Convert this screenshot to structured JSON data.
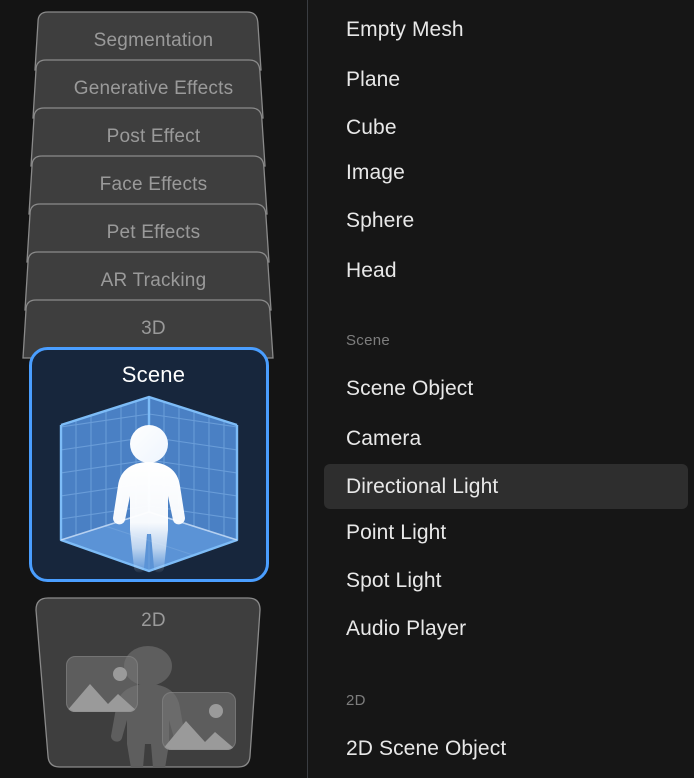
{
  "sidebar": {
    "cards": [
      {
        "label": "Segmentation",
        "selected": false,
        "icon": null
      },
      {
        "label": "Generative Effects",
        "selected": false,
        "icon": null
      },
      {
        "label": "Post Effect",
        "selected": false,
        "icon": null
      },
      {
        "label": "Face Effects",
        "selected": false,
        "icon": null
      },
      {
        "label": "Pet Effects",
        "selected": false,
        "icon": null
      },
      {
        "label": "AR Tracking",
        "selected": false,
        "icon": null
      },
      {
        "label": "3D",
        "selected": false,
        "icon": null
      },
      {
        "label": "Scene",
        "selected": true,
        "icon": "scene-room-person-icon"
      },
      {
        "label": "2D",
        "selected": false,
        "icon": "twod-person-images-icon"
      }
    ]
  },
  "menu": {
    "items": [
      {
        "label": "Empty Mesh",
        "kind": "item",
        "highlighted": false
      },
      {
        "label": "Plane",
        "kind": "item",
        "highlighted": false
      },
      {
        "label": "Cube",
        "kind": "item",
        "highlighted": false
      },
      {
        "label": "Image",
        "kind": "item",
        "highlighted": false
      },
      {
        "label": "Sphere",
        "kind": "item",
        "highlighted": false
      },
      {
        "label": "Head",
        "kind": "item",
        "highlighted": false
      },
      {
        "label": "Scene",
        "kind": "section",
        "highlighted": false
      },
      {
        "label": "Scene Object",
        "kind": "item",
        "highlighted": false
      },
      {
        "label": "Camera",
        "kind": "item",
        "highlighted": false
      },
      {
        "label": "Directional Light",
        "kind": "item",
        "highlighted": true
      },
      {
        "label": "Point Light",
        "kind": "item",
        "highlighted": false
      },
      {
        "label": "Spot Light",
        "kind": "item",
        "highlighted": false
      },
      {
        "label": "Audio Player",
        "kind": "item",
        "highlighted": false
      },
      {
        "label": "2D",
        "kind": "section",
        "highlighted": false
      },
      {
        "label": "2D Scene Object",
        "kind": "item",
        "highlighted": false
      }
    ]
  },
  "colors": {
    "background": "#141414",
    "menu_background": "#161616",
    "card_fill": "#3e3e3e",
    "card_stroke": "#8a8a8a",
    "card_label": "#9a9a9a",
    "selected_border": "#4a9eff",
    "selected_fill": "#17263c",
    "highlight_row": "#2e2e2e",
    "item_text": "#e8e8e8",
    "section_text": "#7d7d7d",
    "divider": "#3a3d42",
    "icon_wall": "#4a80c4",
    "icon_floor": "#5b93d6",
    "icon_grid": "#6fa2dc",
    "icon_edge": "#6db0f0",
    "icon_person": "#ffffff"
  }
}
